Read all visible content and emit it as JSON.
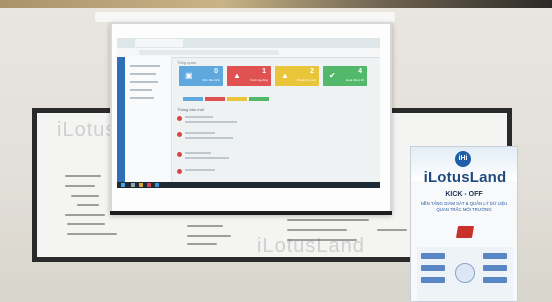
{
  "scene": {
    "description_kind": "photo of projected web dashboard and roll-up banner"
  },
  "projected_app": {
    "page_heading": "Tổng quan",
    "kpis": [
      {
        "value": "0",
        "label": "Cần cấu hình",
        "color": "#5fa8dd",
        "icon": "chip-icon"
      },
      {
        "value": "1",
        "label": "Vượt ngưỡng",
        "color": "#e05252",
        "icon": "warning-icon"
      },
      {
        "value": "2",
        "label": "Chuẩn bị vượt",
        "color": "#e9c53a",
        "icon": "warning-icon"
      },
      {
        "value": "4",
        "label": "Hoạt động tốt",
        "color": "#52b96b",
        "icon": "check-icon"
      }
    ],
    "chip_colors": [
      "#5fa8dd",
      "#e05252",
      "#e9c53a",
      "#52b96b"
    ],
    "alerts_title": "Thông báo mới"
  },
  "banner": {
    "logo_text": "iHi",
    "brand": "iLotusLand",
    "title": "KICK - OFF",
    "subtitle_line1": "NỀN TẢNG GIÁM SÁT & QUẢN LÝ DỮ LIỆU",
    "subtitle_line2": "QUAN TRẮC MÔI TRƯỜNG"
  },
  "whiteboard": {
    "watermark": "iLotusLand"
  }
}
